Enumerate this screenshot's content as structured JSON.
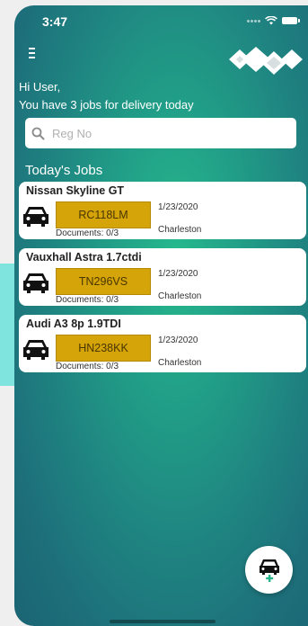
{
  "status_bar": {
    "time": "3:47"
  },
  "header": {
    "greeting_line1": "Hi User,",
    "greeting_line2": "You have 3 jobs for delivery today"
  },
  "search": {
    "placeholder": "Reg No",
    "value": ""
  },
  "jobs_section": {
    "title": "Today's Jobs",
    "items": [
      {
        "title": "Nissan Skyline GT",
        "plate": "RC118LM",
        "documents": "Documents: 0/3",
        "date": "1/23/2020",
        "location": "Charleston"
      },
      {
        "title": "Vauxhall Astra 1.7ctdi",
        "plate": "TN296VS",
        "documents": "Documents: 0/3",
        "date": "1/23/2020",
        "location": "Charleston"
      },
      {
        "title": "Audi A3 8p 1.9TDI",
        "plate": "HN238KK",
        "documents": "Documents: 0/3",
        "date": "1/23/2020",
        "location": "Charleston"
      }
    ]
  },
  "fab": {
    "icon": "add-car-icon"
  },
  "colors": {
    "background_center": "#26b88c",
    "background_edge": "#1b6474",
    "plate": "#d4a408",
    "fab_accent": "#27b48a"
  }
}
